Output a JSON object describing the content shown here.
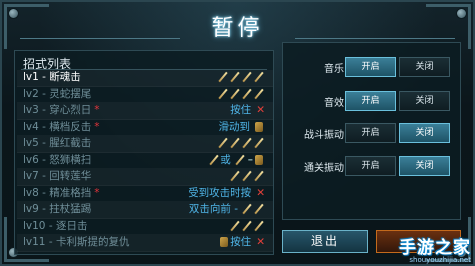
{
  "title": "暂停",
  "move_list": {
    "heading": "招式列表",
    "rows": [
      {
        "name": "lv1 - 断魂击",
        "starred": false,
        "active": true,
        "input_text": "",
        "input_icons": "sword-x4"
      },
      {
        "name": "lv2 - 灵蛇摆尾",
        "starred": false,
        "active": false,
        "input_text": "",
        "input_icons": "sword-x4"
      },
      {
        "name": "lv3 - 穿心烈日",
        "starred": true,
        "active": false,
        "input_text": "按住",
        "input_icons": "x"
      },
      {
        "name": "lv4 - 横档反击",
        "starred": true,
        "active": false,
        "input_text": "滑动到",
        "input_icons": "gem"
      },
      {
        "name": "lv5 - 腥红截击",
        "starred": false,
        "active": false,
        "input_text": "",
        "input_icons": "sword-x4"
      },
      {
        "name": "lv6 - 怒狮横扫",
        "starred": false,
        "active": false,
        "input_text": "或",
        "input_icons": "sword-or-sword"
      },
      {
        "name": "lv7 - 回转莲华",
        "starred": false,
        "active": false,
        "input_text": "",
        "input_icons": "sword-x3"
      },
      {
        "name": "lv8 - 精准格挡",
        "starred": true,
        "active": false,
        "input_text": "受到攻击时按",
        "input_icons": "x"
      },
      {
        "name": "lv9 - 拄杖猛踢",
        "starred": false,
        "active": false,
        "input_text": "双击向前 -",
        "input_icons": "sword-x2"
      },
      {
        "name": "lv10 - 逐日击",
        "starred": false,
        "active": false,
        "input_text": "",
        "input_icons": "sword-x3"
      },
      {
        "name": "lv11 - 卡利斯提的复仇",
        "starred": false,
        "active": false,
        "input_text": "按住",
        "input_icons": "gem-x"
      }
    ]
  },
  "settings": [
    {
      "label": "音乐",
      "on_label": "开启",
      "off_label": "关闭",
      "selected": "on"
    },
    {
      "label": "音效",
      "on_label": "开启",
      "off_label": "关闭",
      "selected": "on"
    },
    {
      "label": "战斗振动",
      "on_label": "开启",
      "off_label": "关闭",
      "selected": "off"
    },
    {
      "label": "通关振动",
      "on_label": "开启",
      "off_label": "关闭",
      "selected": "off"
    }
  ],
  "exit_label": "退出",
  "watermark": {
    "line1": "手游之家",
    "line2": "shouyouzhijia.net"
  },
  "colors": {
    "accent": "#4fb4e6",
    "star": "#e0343b",
    "toggle_on": "#3b7f98",
    "exit": "#27566a"
  }
}
